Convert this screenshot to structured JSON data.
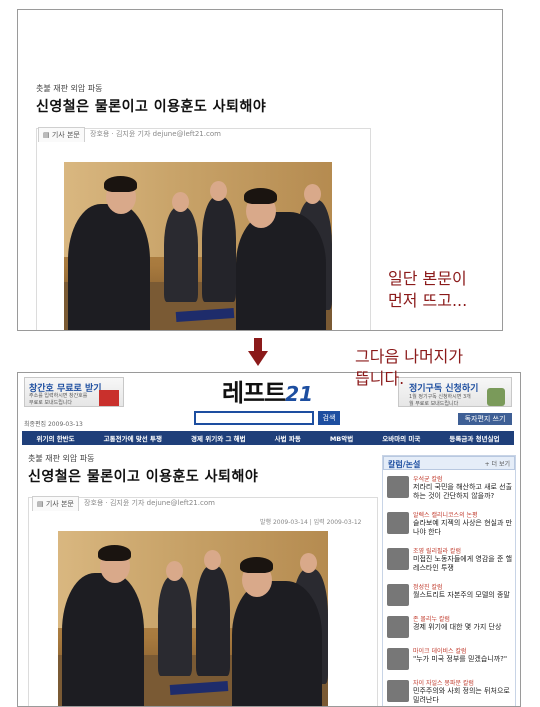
{
  "top_panel": {
    "kicker": "촛불 재판 외압 파동",
    "headline": "신영철은 물론이고 이용훈도 사퇴해야",
    "tab_label": "기사 본문",
    "byline": "장호용 · 김지윤 기자  dejune@left21.com"
  },
  "annotations": {
    "note1_line1": "일단 본문이",
    "note1_line2": "먼저 뜨고...",
    "note2_line1": "그다음 나머지가",
    "note2_line2": "뜹니다."
  },
  "bottom_panel": {
    "promo_left": {
      "title": "창간호 무료로 받기",
      "sub": "주소를 입력하시면 창간호를 무료로 보내드립니다"
    },
    "logo_text": "레프트",
    "logo_num": "21",
    "search_button": "검색",
    "promo_right": {
      "title": "정기구독 신청하기",
      "sub": "1월 정기구독 신청하시면 3개월 무료로 보내드립니다"
    },
    "date": "최종편집 2009-03-13",
    "reader_button": "독자편지 쓰기",
    "nav": [
      "위기의 한반도",
      "고통전가에 맞선 투쟁",
      "경제 위기와 그 해법",
      "사법 파동",
      "MB악법",
      "오바마의 미국",
      "등록금과 청년실업"
    ],
    "kicker": "촛불 재판 외압 파동",
    "headline": "신영철은 물론이고 이용훈도 사퇴해야",
    "tab_label": "기사 본문",
    "byline": "장호용 · 김지윤 기자  dejune@left21.com",
    "dates": "발행 2009-03-14 | 입력 2009-03-12",
    "sidebar": {
      "title": "칼럼/논설",
      "more": "+ 더 보기",
      "items": [
        {
          "cat": "우석균 칼럼",
          "text": "저라리 국민을 해산하고 새로 선출하는 것이 간단하지 않을까?"
        },
        {
          "cat": "알렉스 캘리니코스의 논평",
          "text": "슬라보예 지젝의 사상은 현실과 만나야 한다"
        },
        {
          "cat": "조영 릴리필라 칼럼",
          "text": "미접진 노동자들에게 영감을 준 핼레스타인 투쟁"
        },
        {
          "cat": "정성진 칼럼",
          "text": "월스트리트 자본주의 모델의 종말"
        },
        {
          "cat": "존 몰리누 칼럼",
          "text": "경제 위기에 대한 몇 가지 단상"
        },
        {
          "cat": "마이크 데이비스 칼럼",
          "text": "\"누가 미국 정부를 믿겠습니까?\""
        },
        {
          "cat": "자이 자일스 몽파문 칼럼",
          "text": "민주주의와 사회 정의는 뒤처으로 밀려난다"
        }
      ]
    }
  }
}
